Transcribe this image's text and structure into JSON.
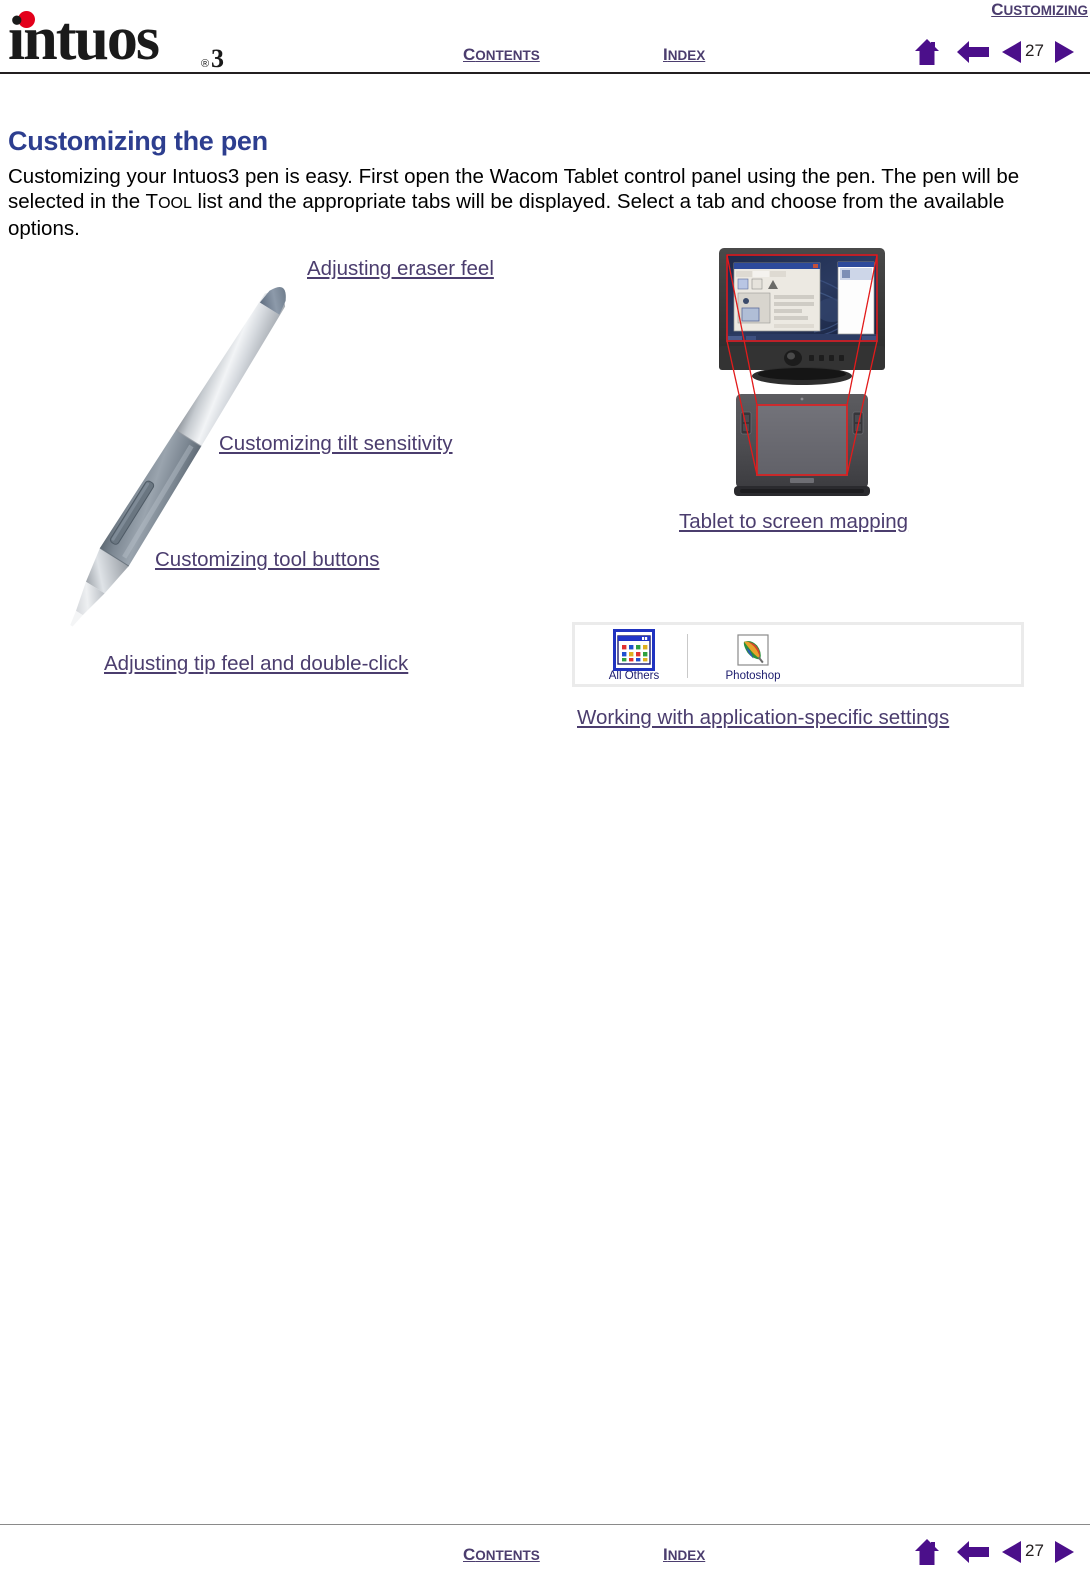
{
  "header": {
    "logo": {
      "wordmark": "intuos",
      "superscript": "3",
      "reg": "®"
    },
    "chapter_title": "CUSTOMIZING",
    "contents_label_first": "C",
    "contents_label_rest": "ONTENTS",
    "index_label_first": "I",
    "index_label_rest": "NDEX",
    "page_number": "27",
    "icons": {
      "home": "home-icon",
      "back": "back-arrow-icon",
      "prev": "previous-page-icon",
      "next": "next-page-icon"
    }
  },
  "content": {
    "heading": "Customizing the pen",
    "intro_part1": "Customizing your Intuos3 pen is easy.  First open the Wacom Tablet control panel using the pen.  The pen will be selected in the ",
    "intro_tool_first": "T",
    "intro_tool_rest": "OOL",
    "intro_part2": " list and the appropriate tabs will be displayed.  Select a tab and choose from the available options.",
    "links": {
      "eraser": "Adjusting eraser feel",
      "tilt": "Customizing tilt sensitivity",
      "tool_buttons": "Customizing tool buttons",
      "tip_feel": "Adjusting tip feel and double-click",
      "mapping": "Tablet to screen mapping",
      "app_specific": "Working with application-specific settings"
    }
  },
  "figures": {
    "pen": {
      "name": "intuos3-grip-pen-photo"
    },
    "mapping": {
      "name": "tablet-to-screen-mapping-diagram"
    },
    "app_strip": {
      "items": [
        {
          "label": "All Others",
          "icon": "all-others-icon",
          "selected": true
        },
        {
          "label": "Photoshop",
          "icon": "photoshop-icon",
          "selected": false
        }
      ]
    }
  },
  "footer": {
    "contents_label_first": "C",
    "contents_label_rest": "ONTENTS",
    "index_label_first": "I",
    "index_label_rest": "NDEX",
    "page_number": "27"
  },
  "colors": {
    "link_purple": "#4b3d6e",
    "heading_blue": "#2d3e8f",
    "nav_purple": "#4b0f8a",
    "logo_red": "#e3001b",
    "selection_blue": "#2033c0",
    "mapping_red": "#e21b1b"
  }
}
